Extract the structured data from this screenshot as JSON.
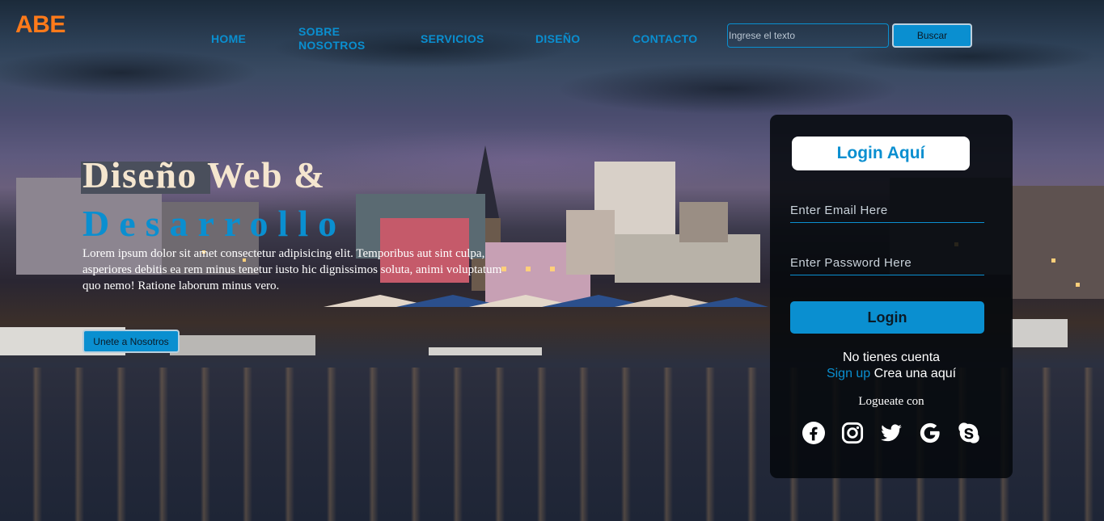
{
  "header": {
    "logo": "ABE",
    "nav": [
      {
        "label": "HOME"
      },
      {
        "label": "SOBRE\nNOSOTROS"
      },
      {
        "label": "SERVICIOS"
      },
      {
        "label": "DISEÑO"
      },
      {
        "label": "CONTACTO"
      }
    ],
    "search": {
      "placeholder": "Ingrese el texto",
      "value": "",
      "button_label": "Buscar"
    }
  },
  "hero": {
    "title_line1": "Diseño Web &",
    "title_line2": "Desarrollo",
    "text": "Lorem ipsum dolor sit amet consectetur adipisicing elit. Temporibus aut sint culpa, asperiores debitis ea rem minus tenetur iusto hic dignissimos soluta, animi voluptatum quo nemo! Ratione laborum minus vero.",
    "cta_label": "Unete a Nosotros"
  },
  "login": {
    "title": "Login Aquí",
    "email_placeholder": "Enter Email Here",
    "password_placeholder": "Enter Password Here",
    "button_label": "Login",
    "no_account": "No tienes cuenta",
    "signup_link": "Sign up",
    "signup_rest": " Crea una aquí",
    "login_with": "Logueate con",
    "social": [
      {
        "icon": "facebook-icon"
      },
      {
        "icon": "instagram-icon"
      },
      {
        "icon": "twitter-icon"
      },
      {
        "icon": "google-icon"
      },
      {
        "icon": "skype-icon"
      }
    ]
  },
  "colors": {
    "accent": "#0a8fd0",
    "logo": "#ff7a1a",
    "title_cream": "#f5e6cf"
  }
}
